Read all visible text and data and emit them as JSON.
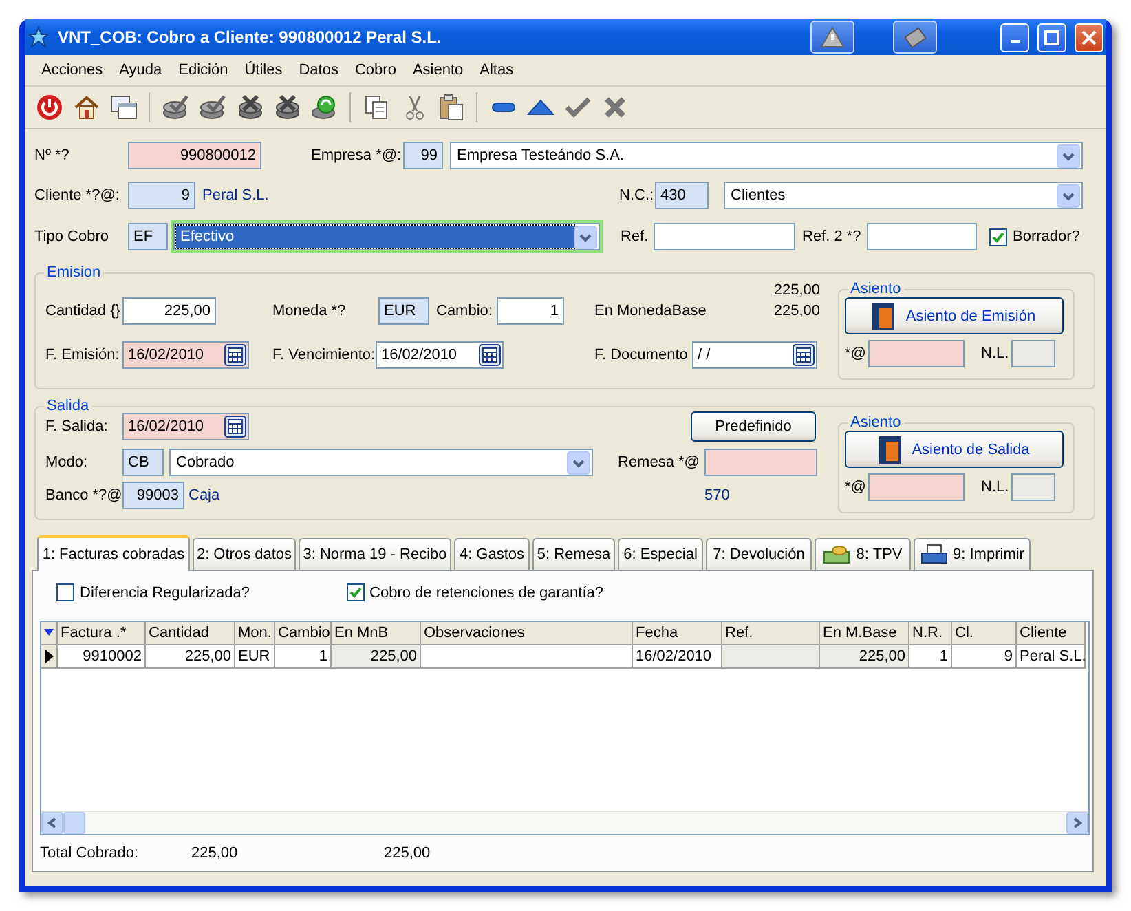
{
  "window": {
    "title": "VNT_COB: Cobro a Cliente: 990800012 Peral S.L."
  },
  "menu": [
    "Acciones",
    "Ayuda",
    "Edición",
    "Útiles",
    "Datos",
    "Cobro",
    "Asiento",
    "Altas"
  ],
  "header": {
    "numero": {
      "label": "Nº *?",
      "value": "990800012"
    },
    "empresa": {
      "label": "Empresa *@:",
      "code": "99",
      "value": "Empresa Testeándo S.A."
    },
    "cliente": {
      "label": "Cliente *?@:",
      "code": "9",
      "name": "Peral S.L."
    },
    "nc": {
      "label": "N.C.:",
      "code": "430",
      "value": "Clientes"
    },
    "tipo_cobro": {
      "label": "Tipo Cobro",
      "code": "EF",
      "value": "Efectivo",
      "focused": true
    },
    "ref": {
      "label": "Ref."
    },
    "ref2": {
      "label": "Ref. 2 *?"
    },
    "borrador": {
      "label": "Borrador?",
      "checked": true
    }
  },
  "emision": {
    "title": "Emision",
    "cantidad": {
      "label": "Cantidad {}",
      "value": "225,00"
    },
    "moneda": {
      "label": "Moneda *?",
      "value": "EUR"
    },
    "cambio": {
      "label": "Cambio:",
      "value": "1"
    },
    "moneda_base": {
      "label": "En MonedaBase",
      "values": [
        "225,00",
        "225,00"
      ]
    },
    "f_emision": {
      "label": "F. Emisión:",
      "value": "16/02/2010"
    },
    "f_vencimiento": {
      "label": "F. Vencimiento:",
      "value": "16/02/2010"
    },
    "f_documento": {
      "label": "F. Documento",
      "value": " / /"
    },
    "asiento": {
      "title": "Asiento",
      "button": "Asiento de Emisión",
      "at_label": "*@",
      "nl_label": "N.L."
    }
  },
  "salida": {
    "title": "Salida",
    "f_salida": {
      "label": "F. Salida:",
      "value": "16/02/2010"
    },
    "predefinido": "Predefinido",
    "modo": {
      "label": "Modo:",
      "code": "CB",
      "value": "Cobrado"
    },
    "remesa": {
      "label": "Remesa *@"
    },
    "banco": {
      "label": "Banco *?@",
      "code": "99003",
      "name": "Caja",
      "account": "570"
    },
    "asiento": {
      "title": "Asiento",
      "button": "Asiento de Salida",
      "at_label": "*@",
      "nl_label": "N.L."
    }
  },
  "tabs": [
    {
      "label": "1: Facturas cobradas",
      "selected": true
    },
    {
      "label": "2: Otros datos",
      "selected": false
    },
    {
      "label": "3: Norma 19 - Recibo",
      "selected": false
    },
    {
      "label": "4: Gastos",
      "selected": false
    },
    {
      "label": "5: Remesa",
      "selected": false
    },
    {
      "label": "6: Especial",
      "selected": false
    },
    {
      "label": "7: Devolución",
      "selected": false
    },
    {
      "label": "8: TPV",
      "selected": false
    },
    {
      "label": "9: Imprimir",
      "selected": false
    }
  ],
  "options": [
    {
      "label": "Diferencia Regularizada?",
      "checked": false
    },
    {
      "label": "Cobro de retenciones de garantía?",
      "checked": true
    }
  ],
  "table": {
    "columns": [
      {
        "label": "Factura .*",
        "kind": "number",
        "readonly": false
      },
      {
        "label": "Cantidad",
        "kind": "number",
        "readonly": false
      },
      {
        "label": "Mon.",
        "kind": "text",
        "readonly": false
      },
      {
        "label": "Cambio",
        "kind": "number",
        "readonly": false
      },
      {
        "label": "En MnB",
        "kind": "number",
        "readonly": true
      },
      {
        "label": "Observaciones",
        "kind": "text",
        "readonly": false
      },
      {
        "label": "Fecha",
        "kind": "text",
        "readonly": false
      },
      {
        "label": "Ref.",
        "kind": "text",
        "readonly": true
      },
      {
        "label": "En M.Base",
        "kind": "number",
        "readonly": true
      },
      {
        "label": "N.R.",
        "kind": "number",
        "readonly": false
      },
      {
        "label": "Cl.",
        "kind": "number",
        "readonly": false
      },
      {
        "label": "Cliente",
        "kind": "text",
        "readonly": false
      }
    ],
    "rows": [
      {
        "current": true,
        "cells": [
          "9910002",
          "225,00",
          "EUR",
          "1",
          "225,00",
          "",
          "16/02/2010",
          "",
          "225,00",
          "1",
          "9",
          "Peral S.L."
        ]
      }
    ]
  },
  "total": {
    "label": "Total Cobrado:",
    "values": [
      "225,00",
      "225,00"
    ]
  }
}
